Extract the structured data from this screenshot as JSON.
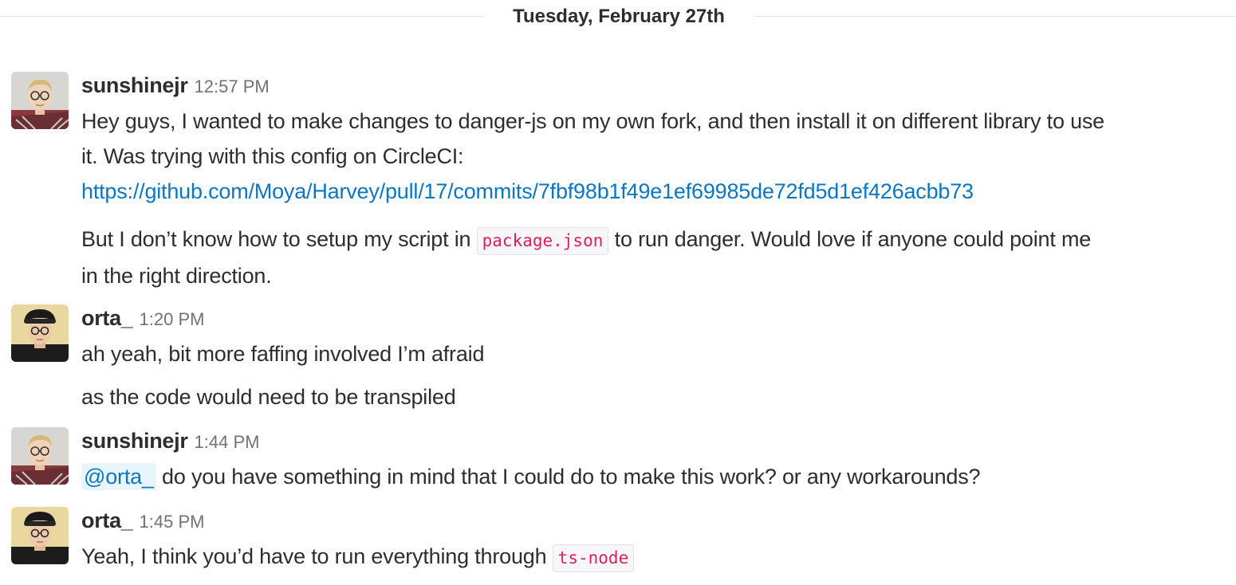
{
  "date_divider": {
    "label": "Tuesday, February 27th"
  },
  "messages": [
    {
      "author": "sunshinejr",
      "time": "12:57 PM",
      "line1": "Hey guys, I wanted to make changes to danger-js on my own fork, and then install it on different library to use",
      "line2": "it. Was trying with this config on CircleCI:",
      "link": "https://github.com/Moya/Harvey/pull/17/commits/7fbf98b1f49e1ef69985de72fd5d1ef426acbb73",
      "para2_before": "But I don’t know how to setup my script in ",
      "para2_code": "package.json",
      "para2_after": " to run danger. Would love if anyone could point me",
      "para2_line2": "in the right direction."
    },
    {
      "author": "orta_",
      "time": "1:20 PM",
      "text1": "ah yeah, bit more faffing involved I’m afraid",
      "text2": "as the code would need to be transpiled"
    },
    {
      "author": "sunshinejr",
      "time": "1:44 PM",
      "mention": "@orta_",
      "text": " do you have something in mind that I could do to make this work? or any workarounds?"
    },
    {
      "author": "orta_",
      "time": "1:45 PM",
      "text_before": "Yeah, I think you’d have to run everything through ",
      "code": "ts-node"
    }
  ],
  "colors": {
    "link": "#0b76c4",
    "code_text": "#e01e5a",
    "timestamp": "#717274"
  }
}
